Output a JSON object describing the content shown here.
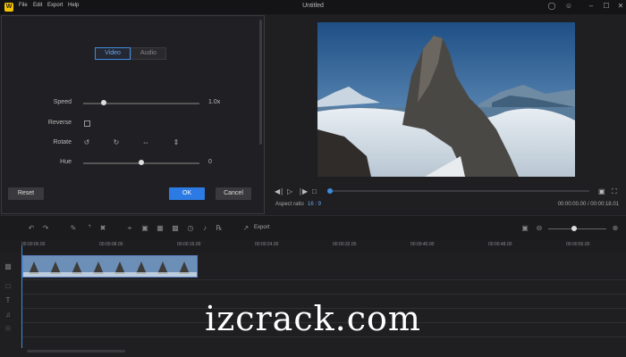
{
  "app": {
    "logo": "W",
    "title": "Untitled",
    "menu": [
      "File",
      "Edit",
      "Export",
      "Help"
    ]
  },
  "window": {
    "icons": [
      "user-icon",
      "feedback-icon",
      "minimize-icon",
      "maximize-icon",
      "close-icon"
    ]
  },
  "panel": {
    "tabs": [
      "Video",
      "Audio"
    ],
    "speed_label": "Speed",
    "speed_value": "1.0x",
    "speed_level": 0.18,
    "reverse_label": "Reverse",
    "rotate_label": "Rotate",
    "hue_label": "Hue",
    "hue_value": "0",
    "hue_level": 0.5,
    "reset": "Reset",
    "ok": "OK",
    "cancel": "Cancel"
  },
  "preview": {
    "aspect_label": "Aspect ratio",
    "aspect_value": "16 : 9",
    "time": "00:00:00.00 / 00:00:18.01"
  },
  "toolbar": {
    "export_label": "Export"
  },
  "timeline": {
    "ticks": [
      "00:00:00.00",
      "00:00:08.00",
      "00:00:16.00",
      "00:00:24.00",
      "00:00:32.00",
      "00:00:40.00",
      "00:00:48.00",
      "00:00:56.00"
    ]
  },
  "watermark": "izcrack.com",
  "colors": {
    "accent": "#2c7be5",
    "logo": "#f5c400"
  }
}
